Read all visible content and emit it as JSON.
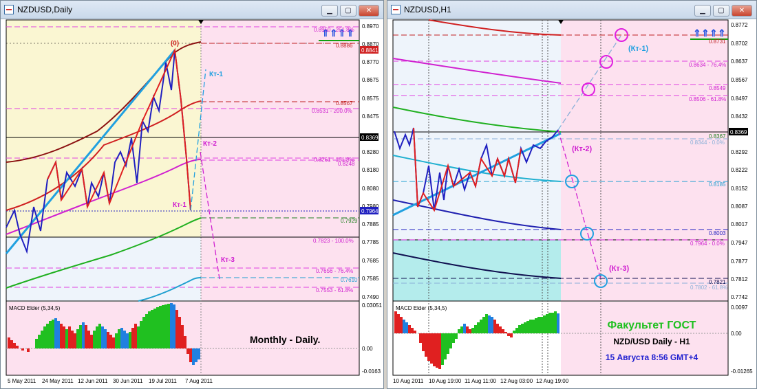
{
  "left": {
    "title": "NZDUSD,Daily",
    "price_labels": [
      {
        "v": "0.8970"
      },
      {
        "v": "0.8870"
      },
      {
        "v": "0.8770"
      },
      {
        "v": "0.8675"
      },
      {
        "v": "0.8575"
      },
      {
        "v": "0.8475"
      },
      {
        "v": "0.8280"
      },
      {
        "v": "0.8180"
      },
      {
        "v": "0.8080"
      },
      {
        "v": "0.7980"
      },
      {
        "v": "0.7885"
      },
      {
        "v": "0.7785"
      },
      {
        "v": "0.7685"
      },
      {
        "v": "0.7585"
      },
      {
        "v": "0.7490"
      }
    ],
    "highlight_prices": {
      "red": "0.8841",
      "black": "0.8369",
      "blue": "0.7964"
    },
    "level_labels": [
      {
        "t": "0.8950 - 261.8%"
      },
      {
        "t": "0.8886"
      },
      {
        "t": "0.8567"
      },
      {
        "t": "0.8531 - 200.0%"
      },
      {
        "t": "0.8261 - 161.8%"
      },
      {
        "t": "0.8248"
      },
      {
        "t": "0.7929"
      },
      {
        "t": "0.7823 - 100.0%"
      },
      {
        "t": "0.7656 - 76.4%"
      },
      {
        "t": "0.7610"
      },
      {
        "t": "0.7553 - 61.8%"
      }
    ],
    "annotations": {
      "peak": "(0)",
      "kt1_up": "Кт-1",
      "kt1_low": "Кт-1",
      "kt2": "Кт-2",
      "kt3": "Кт-3"
    },
    "indicator_title": "MACD Elder (5,34,5)",
    "indicator_scale": [
      "0.03051",
      "0.00",
      "-0.0163"
    ],
    "caption": "Monthly - Daily.",
    "dates": [
      "5 May 2011",
      "24 May 2011",
      "12 Jun 2011",
      "30 Jun 2011",
      "19 Jul 2011",
      "7 Aug 2011"
    ]
  },
  "right": {
    "title": "NZDUSD,H1",
    "price_labels": [
      {
        "v": "0.8772"
      },
      {
        "v": "0.8702"
      },
      {
        "v": "0.8637"
      },
      {
        "v": "0.8567"
      },
      {
        "v": "0.8497"
      },
      {
        "v": "0.8432"
      },
      {
        "v": "0.8292"
      },
      {
        "v": "0.8222"
      },
      {
        "v": "0.8152"
      },
      {
        "v": "0.8087"
      },
      {
        "v": "0.8017"
      },
      {
        "v": "0.7947"
      },
      {
        "v": "0.7877"
      },
      {
        "v": "0.7812"
      },
      {
        "v": "0.7742"
      }
    ],
    "highlight_prices": {
      "black": "0.8369"
    },
    "level_labels": [
      {
        "t": "0.8731"
      },
      {
        "t": "0.8634 - 76.4%"
      },
      {
        "t": "0.8549"
      },
      {
        "t": "0.8506 - 61.8%"
      },
      {
        "t": "0.8367"
      },
      {
        "t": "0.8344 - 0.0%"
      },
      {
        "t": "0.8185"
      },
      {
        "t": "0.8003"
      },
      {
        "t": "0.7964 - 0.0%"
      },
      {
        "t": "0.7821"
      },
      {
        "t": "0.7802 - 61.8%"
      }
    ],
    "annotations": {
      "kt1": "(Кт-1)",
      "kt2": "(Кт-2)",
      "kt3": "(Кт-3)"
    },
    "indicator_title": "MACD Elder (5,34,5)",
    "indicator_scale": [
      "0.0097",
      "0.00",
      "-0.01265"
    ],
    "caption": {
      "line1": "Факультет ГОСТ",
      "line2": "NZD/USD Daily - H1",
      "line3": "15 Августа 8:56 GMT+4"
    },
    "dates": [
      "10 Aug 2011",
      "10 Aug 19:00",
      "11 Aug 11:00",
      "12 Aug 03:00",
      "12 Aug 19:00"
    ]
  },
  "colors": {
    "yellow_zone": "#faf6d2",
    "pink_zone": "#fde1ef",
    "lightblue_zone": "#eef4fb",
    "cyan_zone": "#b4ecec"
  }
}
